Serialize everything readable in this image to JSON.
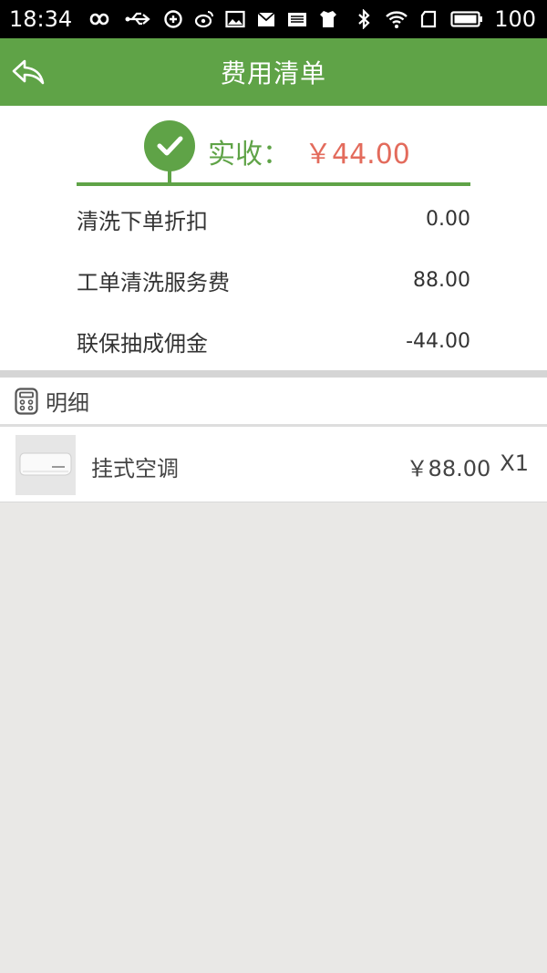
{
  "status_bar": {
    "time": "18:34",
    "battery": "100"
  },
  "header": {
    "title": "费用清单"
  },
  "summary": {
    "total_label": "实收：",
    "total_value": "￥44.00",
    "fees": [
      {
        "label": "清洗下单折扣",
        "value": "0.00"
      },
      {
        "label": "工单清洗服务费",
        "value": "88.00"
      },
      {
        "label": "联保抽成佣金",
        "value": "-44.00"
      }
    ]
  },
  "detail": {
    "title": "明细",
    "items": [
      {
        "name": "挂式空调",
        "price": "￥88.00",
        "qty": "X1"
      }
    ]
  },
  "colors": {
    "brand_green": "#5fa347",
    "price_red": "#e36b5c",
    "background": "#e9e8e6"
  }
}
